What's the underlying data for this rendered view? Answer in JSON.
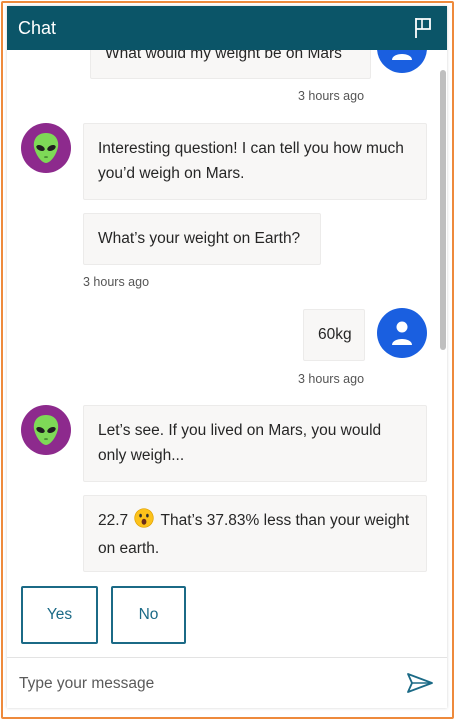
{
  "header": {
    "title": "Chat",
    "flag_icon": "flag-icon"
  },
  "messages": [
    {
      "sender": "user",
      "text": "What would my weight be on Mars",
      "time": "3 hours ago"
    },
    {
      "sender": "bot",
      "text": "Interesting question! I can tell you how much you’d weigh on Mars."
    },
    {
      "sender": "bot",
      "text": "What’s your weight on Earth?",
      "time": "3 hours ago"
    },
    {
      "sender": "user",
      "text": "60kg",
      "time": "3 hours ago"
    },
    {
      "sender": "bot",
      "text": "Let’s see. If you lived on Mars, you would only weigh..."
    },
    {
      "sender": "bot",
      "text_before": "22.7",
      "emoji": "astonished-face-emoji",
      "text_after": "That’s 37.83% less than your weight on earth."
    }
  ],
  "suggested_actions": [
    {
      "label": "Yes"
    },
    {
      "label": "No"
    }
  ],
  "composer": {
    "placeholder": "Type your message",
    "send_icon": "send-icon"
  },
  "colors": {
    "header": "#0b5568",
    "bot_avatar": "#8d2a8d",
    "user_avatar": "#1a5fe0",
    "accent": "#1b6a86",
    "frame": "#ee8a3c"
  }
}
